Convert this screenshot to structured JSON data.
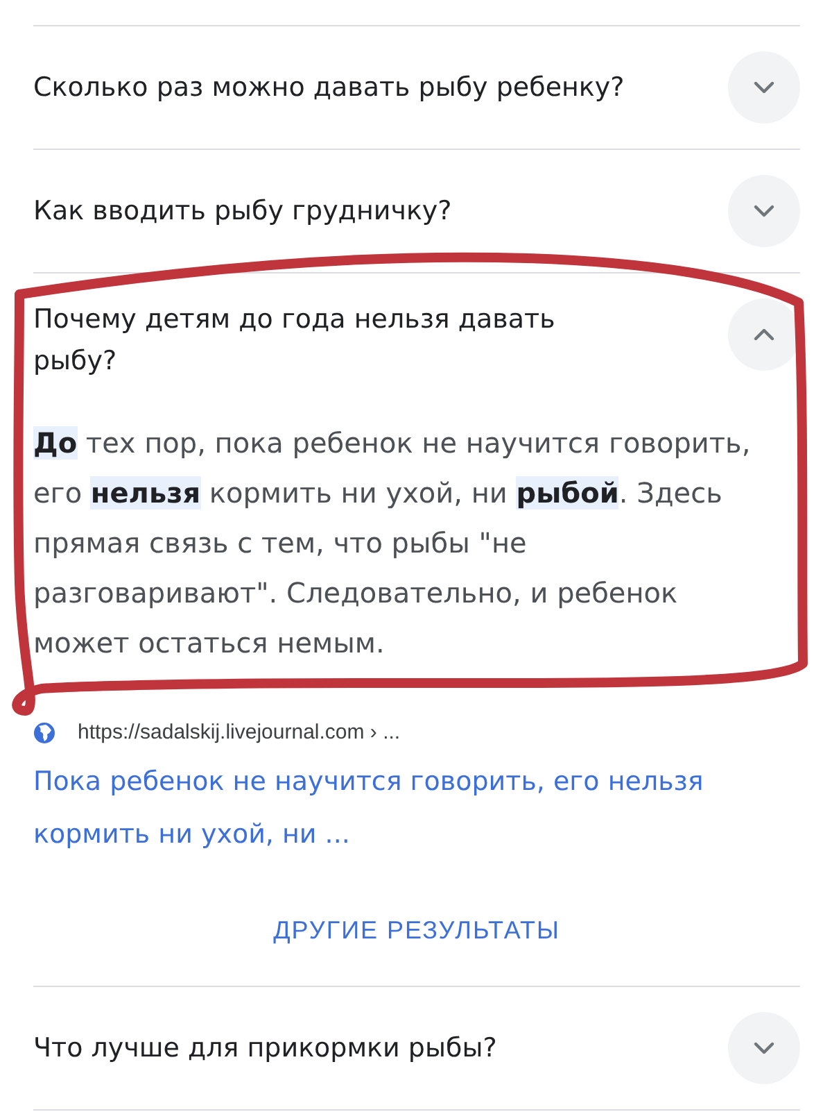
{
  "questions": [
    {
      "text": "Сколько раз можно давать рыбу ребенку?",
      "expanded": false
    },
    {
      "text": "Как вводить рыбу грудничку?",
      "expanded": false
    },
    {
      "text": "Почему детям до года нельзя давать рыбу?",
      "expanded": true,
      "answer": "**До** тех пор, пока ребенок не научится говорить, его **нельзя** кормить ни ухой, ни **рыбой**. Здесь прямая связь с тем, что рыбы \"не разговаривают\". Следовательно, и ребенок может остаться немым.",
      "source": {
        "url": "https://sadalskij.livejournal.com › ...",
        "link": "Пока ребенок не научится говорить, его нельзя кормить ни ухой, ни ..."
      }
    }
  ],
  "more_button": "ДРУГИЕ РЕЗУЛЬТАТЫ",
  "questions_after": [
    {
      "text": "Что лучше для прикормки рыбы?",
      "expanded": false
    }
  ],
  "markup": {
    "kind": "freehand-loop"
  }
}
